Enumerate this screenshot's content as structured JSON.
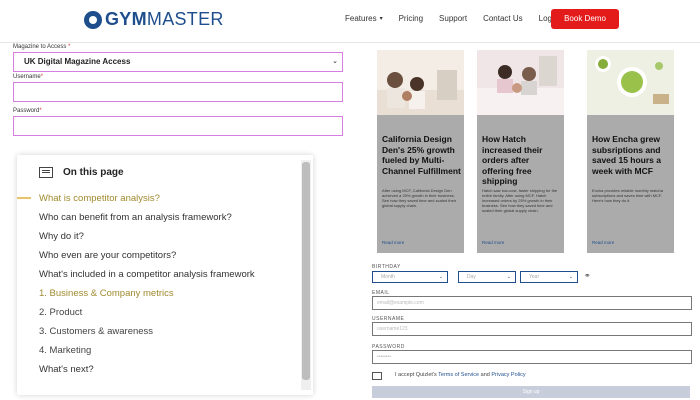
{
  "header": {
    "brand_bold": "GYM",
    "brand_thin": "MASTER",
    "nav": [
      {
        "label": "Features",
        "has_caret": true
      },
      {
        "label": "Pricing"
      },
      {
        "label": "Support"
      },
      {
        "label": "Contact Us"
      },
      {
        "label": "Login"
      }
    ],
    "cta": "Book Demo",
    "cta_color": "#e31b1b"
  },
  "form": {
    "magazine_label": "Magazine to Access",
    "magazine_value": "UK Digital Magazine Access",
    "username_label": "Username",
    "password_label": "Password",
    "required_mark": "*",
    "accent_color": "#d77fe0"
  },
  "toc": {
    "title": "On this page",
    "items": [
      "What is competitor analysis?",
      "Who can benefit from an analysis framework?",
      "Why do it?",
      "Who even are your competitors?",
      "What's included in a competitor analysis framework",
      "1. Business & Company metrics",
      "2. Product",
      "3. Customers & awareness",
      "4. Marketing",
      "What's next?"
    ],
    "active_color": "#a08a2e"
  },
  "cards": [
    {
      "title": "California Design Den's 25% growth fueled by Multi-Channel Fulfillment",
      "desc": "After using MCF, California Design Den achieved a 25% growth in their business. See how they saved time and scaled their global supply chain.",
      "link": "Read more"
    },
    {
      "title": "How Hatch increased their orders after offering free shipping",
      "desc": "Hatch saw low-cost, faster shipping for the entire family. After using MCF, Hatch increased orders by 25% growth in their business. See how they saved time and scaled their global supply chain.",
      "link": "Read more"
    },
    {
      "title": "How Encha grew subsriptions and saved 15 hours a week with MCF",
      "desc": "Encha provides reliable monthly matcha subscriptions and saves time with MCF. Here's how they do it.",
      "link": "Read more"
    }
  ],
  "signup": {
    "birthday_label": "BIRTHDAY",
    "month_placeholder": "Month",
    "day_placeholder": "Day",
    "year_placeholder": "Year",
    "email_label": "EMAIL",
    "email_placeholder": "email@example.com",
    "username_label": "USERNAME",
    "username_placeholder": "username123",
    "password_label": "PASSWORD",
    "password_placeholder": "••••••••",
    "agree_prefix": "I accept Quizlet's",
    "terms_link": "Terms of Service",
    "and_text": "and",
    "privacy_link": "Privacy Policy",
    "button": "Sign up"
  }
}
